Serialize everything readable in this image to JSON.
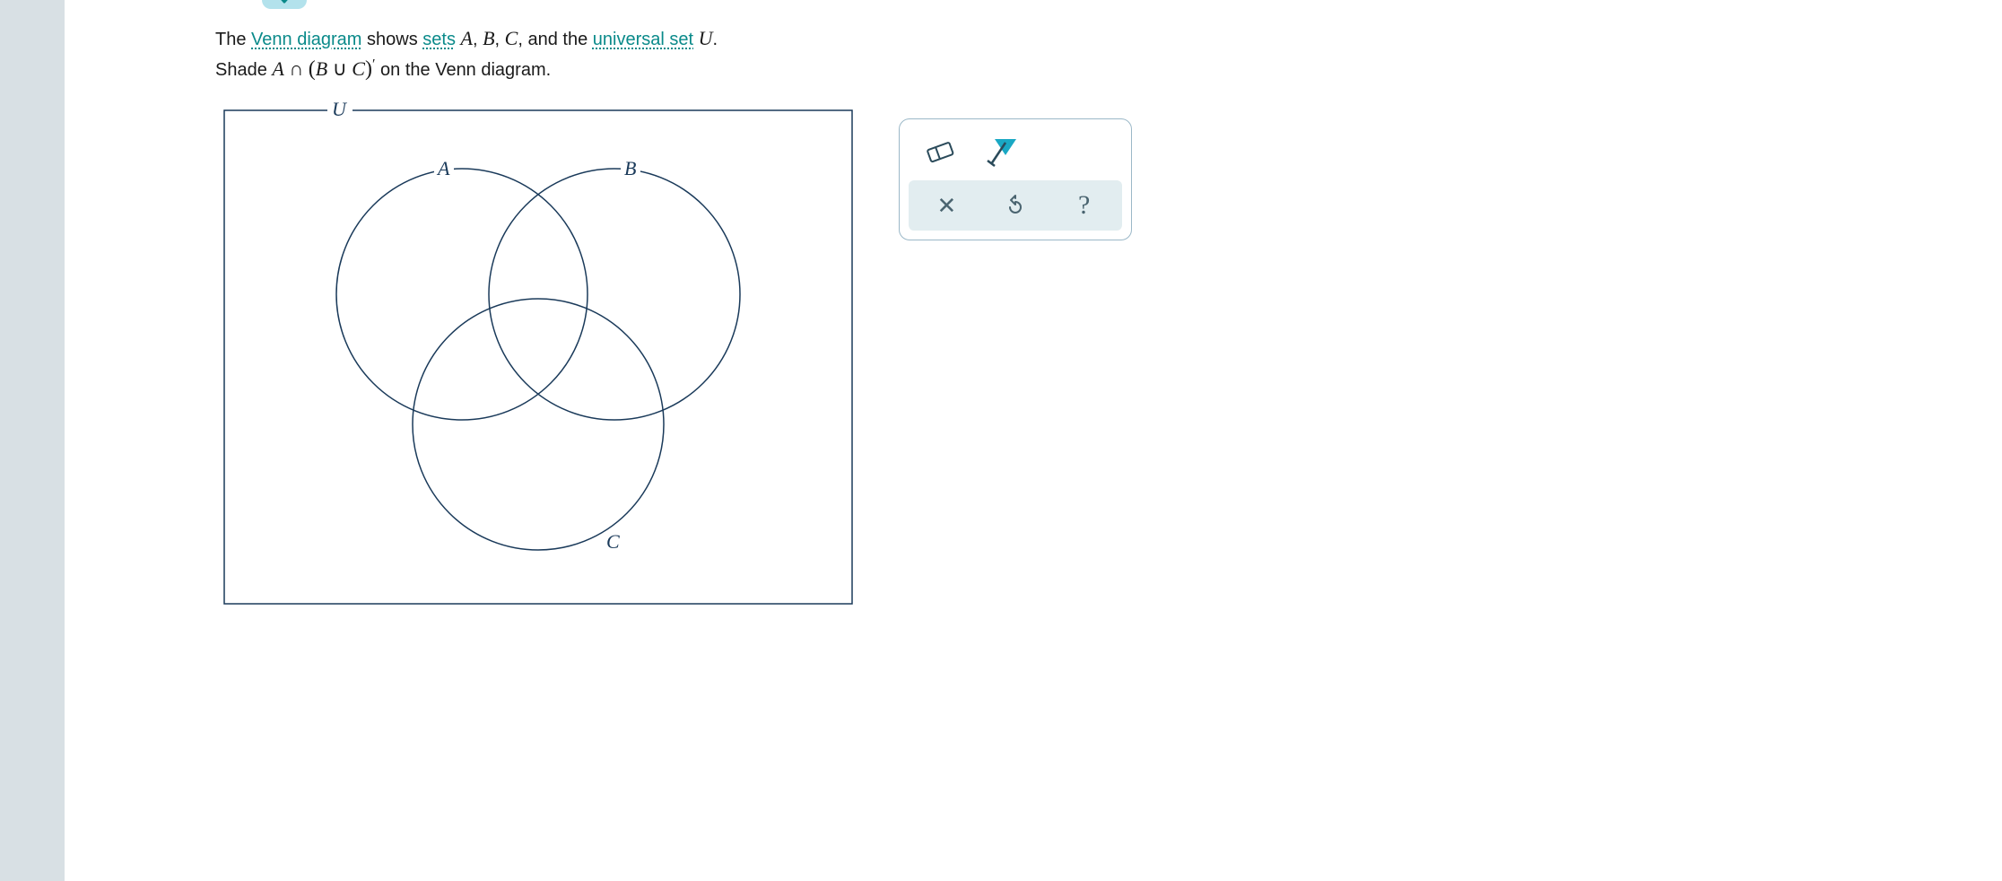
{
  "question": {
    "line1_prefix": "The ",
    "link1": "Venn diagram",
    "mid1": " shows ",
    "link2": "sets",
    "mid2": " ",
    "sets_phrase_html": "A, B, C,",
    "mid3": " and the ",
    "link3": "universal set",
    "mid4": " ",
    "u_var": "U",
    "period": ".",
    "line2_prefix": "Shade ",
    "expr_A": "A",
    "expr_cap": " ∩ ",
    "expr_lparen": "(",
    "expr_B": "B",
    "expr_cup": " ∪ ",
    "expr_C": "C",
    "expr_rparen": ")",
    "expr_prime": "′",
    "line2_suffix": " on the Venn diagram."
  },
  "venn": {
    "labelU": "U",
    "labelA": "A",
    "labelB": "B",
    "labelC": "C"
  },
  "toolbox": {
    "eraser_name": "eraser",
    "shade_name": "shade-tool",
    "clear": "✕",
    "reset": "↺",
    "help": "?"
  }
}
